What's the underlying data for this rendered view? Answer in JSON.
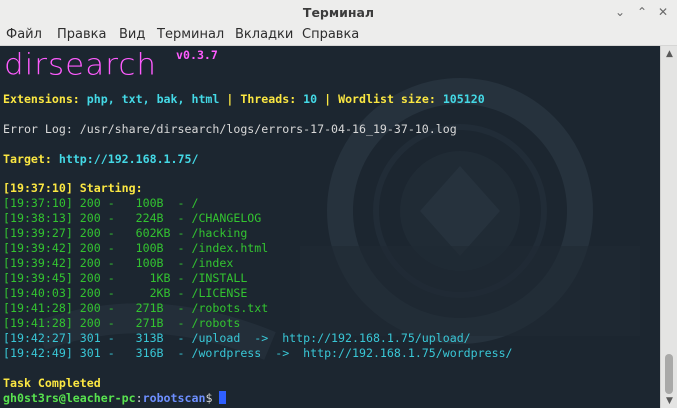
{
  "window": {
    "title": "Терминал",
    "minimize_glyph": "⌄",
    "maximize_glyph": "⌃",
    "close_glyph": "✕"
  },
  "menu": [
    "Файл",
    "Правка",
    "Вид",
    "Терминал",
    "Вкладки",
    "Справка"
  ],
  "terminal": {
    "logo_text": "dirsearch",
    "version": "v0.3.7",
    "extensions_label": "Extensions:",
    "extensions_value": "php, txt, bak, html",
    "threads_label": "Threads:",
    "threads_value": "10",
    "wordlist_label": "Wordlist size:",
    "wordlist_value": "105120",
    "separator": "|",
    "error_log": "Error Log: /usr/share/dirsearch/logs/errors-17-04-16_19-37-10.log",
    "target_label": "Target:",
    "target_value": "http://192.168.1.75/",
    "starting": "[19:37:10] Starting:",
    "results": [
      {
        "text": "[19:37:10] 200 -   100B  - /",
        "kind": "ok"
      },
      {
        "text": "[19:38:13] 200 -   224B  - /CHANGELOG",
        "kind": "ok"
      },
      {
        "text": "[19:39:27] 200 -   602KB - /hacking",
        "kind": "ok"
      },
      {
        "text": "[19:39:42] 200 -   100B  - /index.html",
        "kind": "ok"
      },
      {
        "text": "[19:39:42] 200 -   100B  - /index",
        "kind": "ok"
      },
      {
        "text": "[19:39:45] 200 -     1KB - /INSTALL",
        "kind": "ok"
      },
      {
        "text": "[19:40:03] 200 -     2KB - /LICENSE",
        "kind": "ok"
      },
      {
        "text": "[19:41:28] 200 -   271B  - /robots.txt",
        "kind": "ok"
      },
      {
        "text": "[19:41:28] 200 -   271B  - /robots",
        "kind": "ok"
      },
      {
        "text": "[19:42:27] 301 -   313B  - /upload  ->  http://192.168.1.75/upload/",
        "kind": "redirect"
      },
      {
        "text": "[19:42:49] 301 -   316B  - /wordpress  ->  http://192.168.1.75/wordpress/",
        "kind": "redirect"
      }
    ],
    "task_completed": "Task Completed",
    "prompt_user": "gh0st3rs@leacher-pc",
    "prompt_colon": ":",
    "prompt_dir": "robotscan",
    "prompt_symbol": "$"
  },
  "colors": {
    "terminal_bg": "#1c2630",
    "logo": "#ff5cff",
    "yellow": "#fbe742",
    "cyan": "#44d9e6",
    "green": "#33c430",
    "cursor": "#2f5fff"
  }
}
